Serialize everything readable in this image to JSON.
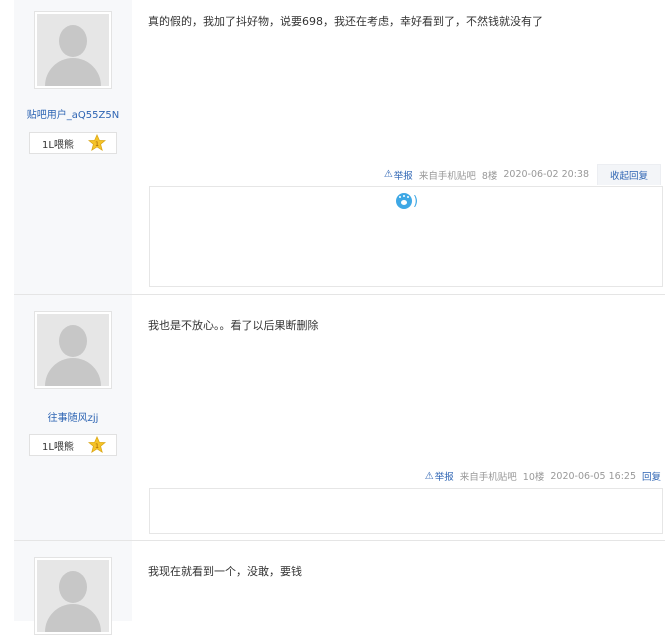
{
  "posts": [
    {
      "username": "贴吧用户_aQ55Z5N",
      "level_name": "1L喂熊",
      "level": "1",
      "content": "真的假的，我加了抖好物，说要698，我还在考虑，幸好看到了，不然钱就没有了",
      "report": "举报",
      "source": "来自手机贴吧",
      "floor": "8楼",
      "time": "2020-06-02 20:38",
      "reply_action": "收起回复",
      "reply_emoji": ")"
    },
    {
      "username": "往事随风zjj",
      "level_name": "1L喂熊",
      "level": "1",
      "content": "我也是不放心。。看了以后果断删除",
      "report": "举报",
      "source": "来自手机贴吧",
      "floor": "10楼",
      "time": "2020-06-05 16:25",
      "reply_action": "回复"
    },
    {
      "content": "我现在就看到一个，没敢，要钱"
    }
  ],
  "colors": {
    "link": "#2d64b3",
    "meta": "#999999",
    "sidebar_bg": "#f7f8fa",
    "badge_star": "#f5c328"
  },
  "icons": {
    "report": "warning-icon",
    "level": "star-badge-icon",
    "emoji": "paw-emoji-icon"
  }
}
